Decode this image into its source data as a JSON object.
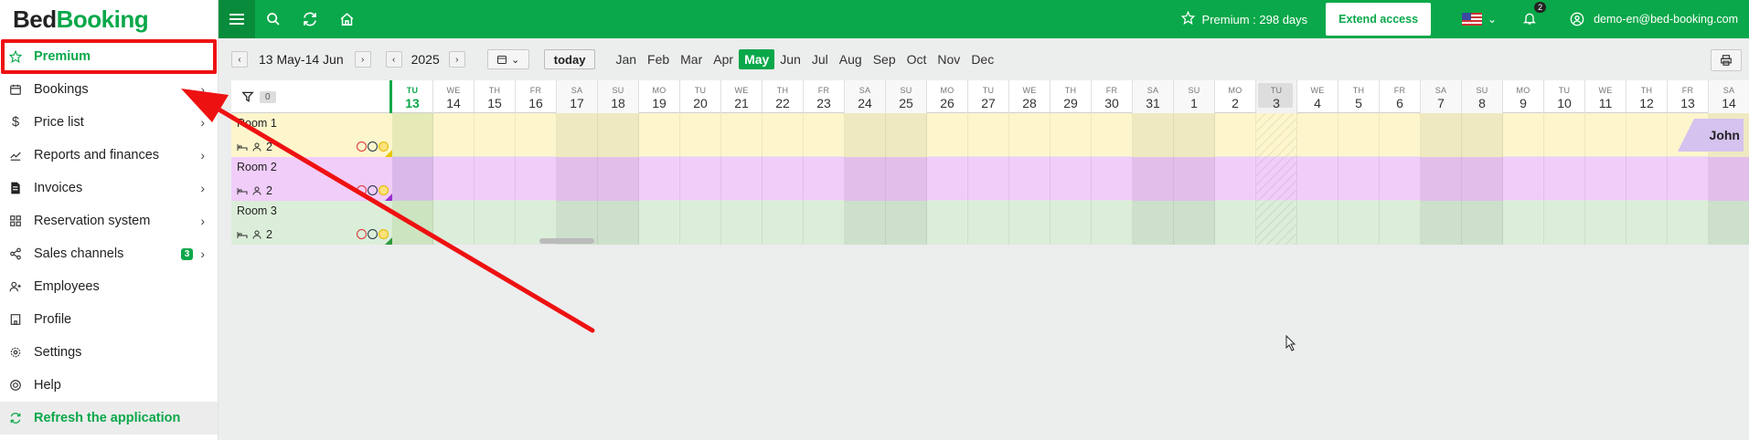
{
  "app": {
    "logo_part1": "Bed",
    "logo_part2": "Booking"
  },
  "sidebar": {
    "items": [
      {
        "label": "Premium",
        "icon": "star-icon"
      },
      {
        "label": "Bookings",
        "icon": "calendar-icon"
      },
      {
        "label": "Price list",
        "icon": "dollar-icon"
      },
      {
        "label": "Reports and finances",
        "icon": "chart-icon"
      },
      {
        "label": "Invoices",
        "icon": "invoice-icon"
      },
      {
        "label": "Reservation system",
        "icon": "grid-icon"
      },
      {
        "label": "Sales channels",
        "icon": "share-icon",
        "badge": "3"
      },
      {
        "label": "Employees",
        "icon": "user-add-icon"
      },
      {
        "label": "Profile",
        "icon": "building-icon"
      },
      {
        "label": "Settings",
        "icon": "gear-icon"
      },
      {
        "label": "Help",
        "icon": "help-icon"
      },
      {
        "label": "Refresh the application",
        "icon": "refresh-icon"
      }
    ]
  },
  "topbar": {
    "premium_text": "Premium : 298 days",
    "extend_label": "Extend access",
    "notifications_count": "2",
    "user_email": "demo-en@bed-booking.com"
  },
  "toolbar": {
    "range": "13 May-14 Jun",
    "year": "2025",
    "today_label": "today",
    "months": [
      "Jan",
      "Feb",
      "Mar",
      "Apr",
      "May",
      "Jun",
      "Jul",
      "Aug",
      "Sep",
      "Oct",
      "Nov",
      "Dec"
    ],
    "active_month": "May"
  },
  "grid": {
    "filter_count": "0",
    "days": [
      {
        "dn": "TU",
        "dd": "13"
      },
      {
        "dn": "WE",
        "dd": "14"
      },
      {
        "dn": "TH",
        "dd": "15"
      },
      {
        "dn": "FR",
        "dd": "16"
      },
      {
        "dn": "SA",
        "dd": "17"
      },
      {
        "dn": "SU",
        "dd": "18"
      },
      {
        "dn": "MO",
        "dd": "19"
      },
      {
        "dn": "TU",
        "dd": "20"
      },
      {
        "dn": "WE",
        "dd": "21"
      },
      {
        "dn": "TH",
        "dd": "22"
      },
      {
        "dn": "FR",
        "dd": "23"
      },
      {
        "dn": "SA",
        "dd": "24"
      },
      {
        "dn": "SU",
        "dd": "25"
      },
      {
        "dn": "MO",
        "dd": "26"
      },
      {
        "dn": "TU",
        "dd": "27"
      },
      {
        "dn": "WE",
        "dd": "28"
      },
      {
        "dn": "TH",
        "dd": "29"
      },
      {
        "dn": "FR",
        "dd": "30"
      },
      {
        "dn": "SA",
        "dd": "31"
      },
      {
        "dn": "SU",
        "dd": "1"
      },
      {
        "dn": "MO",
        "dd": "2"
      },
      {
        "dn": "TU",
        "dd": "3"
      },
      {
        "dn": "WE",
        "dd": "4"
      },
      {
        "dn": "TH",
        "dd": "5"
      },
      {
        "dn": "FR",
        "dd": "6"
      },
      {
        "dn": "SA",
        "dd": "7"
      },
      {
        "dn": "SU",
        "dd": "8"
      },
      {
        "dn": "MO",
        "dd": "9"
      },
      {
        "dn": "TU",
        "dd": "10"
      },
      {
        "dn": "WE",
        "dd": "11"
      },
      {
        "dn": "TH",
        "dd": "12"
      },
      {
        "dn": "FR",
        "dd": "13"
      },
      {
        "dn": "SA",
        "dd": "14"
      }
    ],
    "rooms": [
      {
        "name": "Room 1",
        "beds": "2",
        "color": "#fdf6cc",
        "weekend_color": "#efe9c2",
        "corner": "#e8c800",
        "booking": "John"
      },
      {
        "name": "Room 2",
        "beds": "2",
        "color": "#f1cdfa",
        "weekend_color": "#e2bfeb",
        "corner": "#9a2fd0",
        "booking": ""
      },
      {
        "name": "Room 3",
        "beds": "2",
        "color": "#dbeed9",
        "weekend_color": "#cce0cb",
        "corner": "#2f9a3f",
        "booking": ""
      }
    ]
  },
  "colors": {
    "brand": "#0aa84a",
    "annotation": "#e11"
  }
}
